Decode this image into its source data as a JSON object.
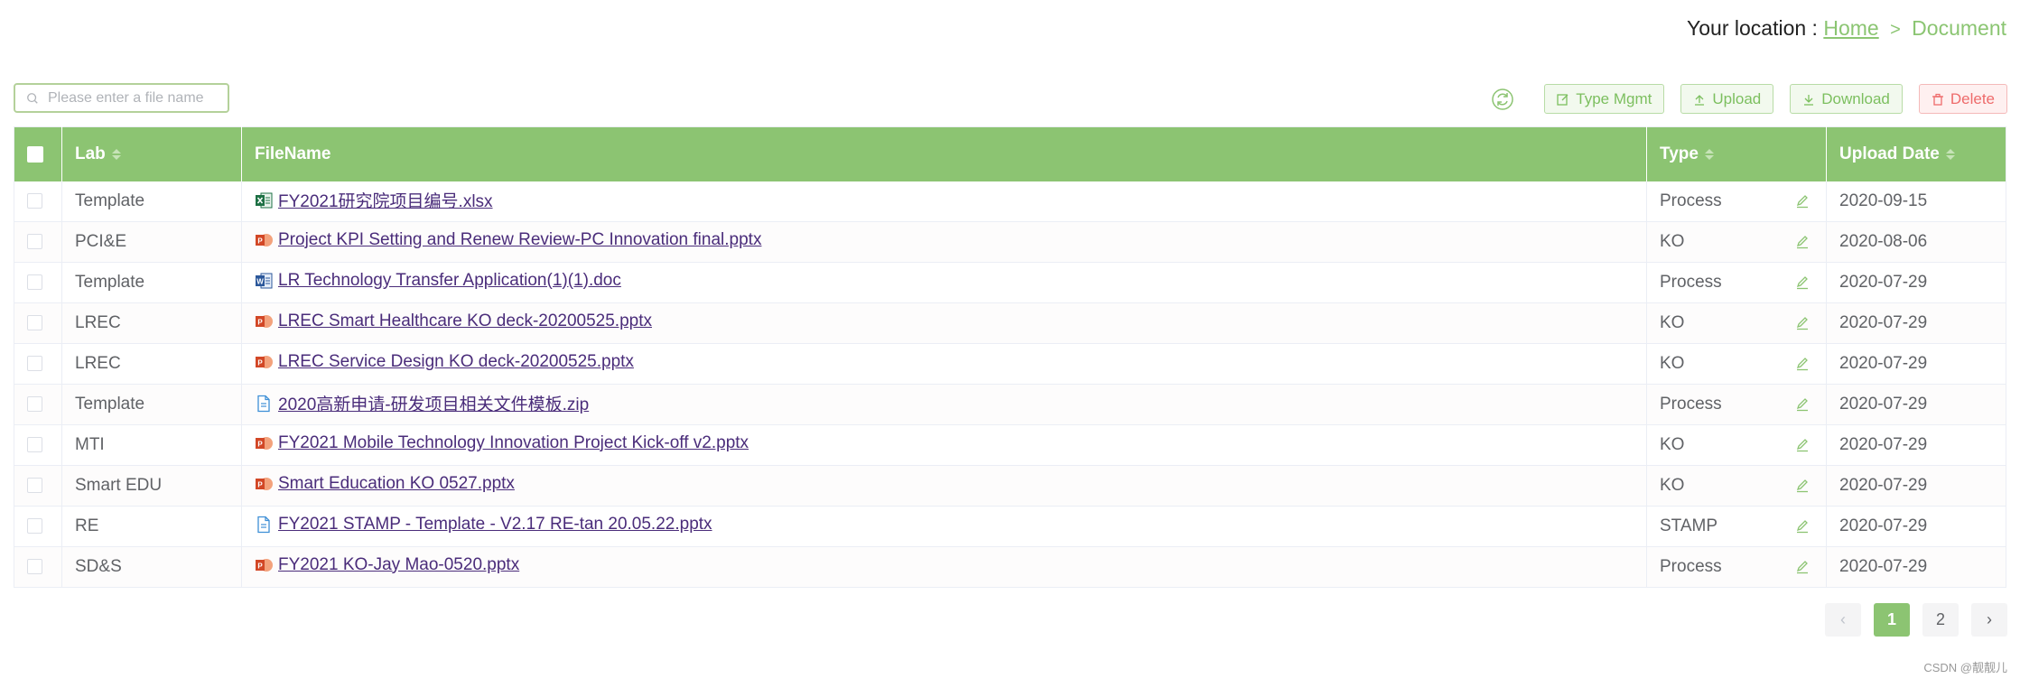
{
  "breadcrumb": {
    "prefix": "Your location :",
    "home": "Home",
    "separator": ">",
    "current": "Document"
  },
  "search": {
    "placeholder": "Please enter a file name"
  },
  "toolbar": {
    "type_mgmt": "Type Mgmt",
    "upload": "Upload",
    "download": "Download",
    "delete": "Delete"
  },
  "table": {
    "headers": {
      "lab": "Lab",
      "filename": "FileName",
      "type": "Type",
      "upload_date": "Upload Date"
    },
    "rows": [
      {
        "lab": "Template",
        "file_icon": "excel-file-icon",
        "filename": "FY2021研究院项目编号.xlsx",
        "type": "Process",
        "date": "2020-09-15"
      },
      {
        "lab": "PCI&E",
        "file_icon": "powerpoint-file-icon",
        "filename": "Project KPI Setting and Renew Review-PC Innovation final.pptx",
        "type": "KO",
        "date": "2020-08-06"
      },
      {
        "lab": "Template",
        "file_icon": "word-file-icon",
        "filename": "LR Technology Transfer Application(1)(1).doc",
        "type": "Process",
        "date": "2020-07-29"
      },
      {
        "lab": "LREC",
        "file_icon": "powerpoint-file-icon",
        "filename": "LREC Smart Healthcare KO deck-20200525.pptx",
        "type": "KO",
        "date": "2020-07-29"
      },
      {
        "lab": "LREC",
        "file_icon": "powerpoint-file-icon",
        "filename": "LREC Service Design KO deck-20200525.pptx",
        "type": "KO",
        "date": "2020-07-29"
      },
      {
        "lab": "Template",
        "file_icon": "generic-file-icon",
        "filename": "2020高新申请-研发项目相关文件模板.zip",
        "type": "Process",
        "date": "2020-07-29"
      },
      {
        "lab": "MTI",
        "file_icon": "powerpoint-file-icon",
        "filename": "FY2021 Mobile Technology Innovation Project Kick-off v2.pptx",
        "type": "KO",
        "date": "2020-07-29"
      },
      {
        "lab": "Smart EDU",
        "file_icon": "powerpoint-file-icon",
        "filename": "Smart Education KO 0527.pptx",
        "type": "KO",
        "date": "2020-07-29"
      },
      {
        "lab": "RE",
        "file_icon": "generic-file-icon",
        "filename": "FY2021 STAMP - Template - V2.17 RE-tan 20.05.22.pptx",
        "type": "STAMP",
        "date": "2020-07-29"
      },
      {
        "lab": "SD&S",
        "file_icon": "powerpoint-file-icon",
        "filename": "FY2021 KO-Jay Mao-0520.pptx",
        "type": "Process",
        "date": "2020-07-29"
      }
    ]
  },
  "pagination": {
    "prev": "‹",
    "next": "›",
    "pages": [
      "1",
      "2"
    ],
    "current": "1"
  },
  "watermark": "CSDN @靓靓儿",
  "colors": {
    "accent": "#8cc472",
    "link": "#4a2c7a",
    "danger": "#ee6b6b"
  }
}
